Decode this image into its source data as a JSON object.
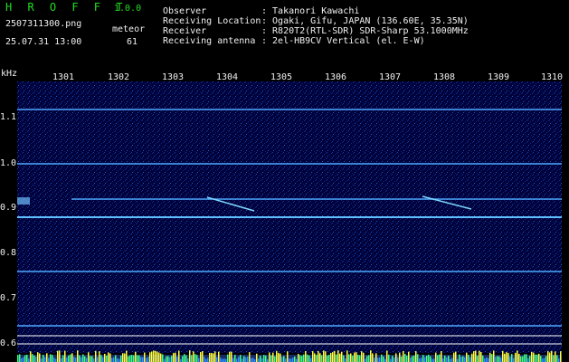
{
  "app": {
    "name": "H R O F F T",
    "version": "1.0.0"
  },
  "file": {
    "name": "2507311300.png",
    "datetime": "25.07.31 13:00"
  },
  "meteor": {
    "label": "meteor",
    "count": "61"
  },
  "info": [
    {
      "key": "Observer",
      "value": ": Takanori Kawachi"
    },
    {
      "key": "Receiving Location",
      "value": ": Ogaki, Gifu, JAPAN (136.60E, 35.35N)"
    },
    {
      "key": "Receiver",
      "value": ": R820T2(RTL-SDR) SDR-Sharp 53.1000MHz"
    },
    {
      "key": "Receiving antenna",
      "value": ": 2el-HB9CV Vertical (el. E-W)"
    }
  ],
  "axes": {
    "y_unit": "kHz",
    "x_ticks": [
      "1301",
      "1302",
      "1303",
      "1304",
      "1305",
      "1306",
      "1307",
      "1308",
      "1309",
      "1310"
    ],
    "y_ticks": [
      "1.1",
      "1.0",
      "0.9",
      "0.8",
      "0.7",
      "0.6"
    ]
  },
  "colors": {
    "background": "#000000",
    "title": "#22dd22",
    "text": "#f0f0f0",
    "counter": "#ffff33",
    "spectrum": "#00002a",
    "signal": "#40a0ff"
  }
}
